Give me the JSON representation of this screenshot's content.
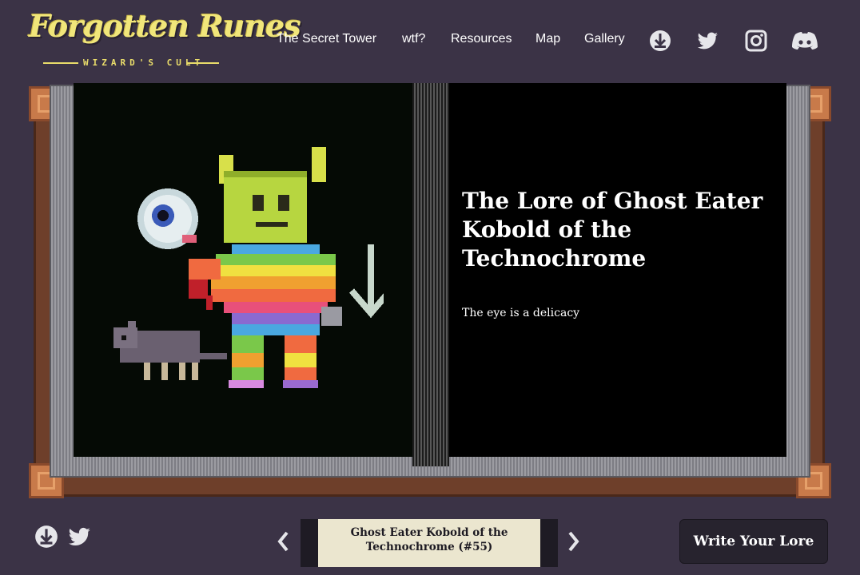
{
  "header": {
    "logo_title": "Forgotten Runes",
    "logo_subtitle": "WIZARD'S CULT",
    "nav": [
      {
        "label": "The Secret Tower"
      },
      {
        "label": "wtf?"
      },
      {
        "label": "Resources"
      },
      {
        "label": "Map"
      },
      {
        "label": "Gallery"
      }
    ],
    "social_icons": [
      "opensea-icon",
      "twitter-icon",
      "instagram-icon",
      "discord-icon"
    ]
  },
  "book": {
    "lore_title": "The Lore of Ghost Eater Kobold of the Technochrome",
    "lore_text": "The eye is a delicacy"
  },
  "footer": {
    "icons": [
      "opensea-icon",
      "twitter-icon"
    ],
    "character_label": "Ghost Eater Kobold of the Technochrome (#55)",
    "write_button": "Write Your Lore"
  },
  "colors": {
    "background": "#3b3346",
    "logo": "#f1e67a",
    "book_cover": "#6e3f2a",
    "book_corner": "#c87a4a",
    "page_left": "#050a05",
    "page_right": "#000000",
    "scroll": "#ebe6cf",
    "button": "#27232e"
  }
}
